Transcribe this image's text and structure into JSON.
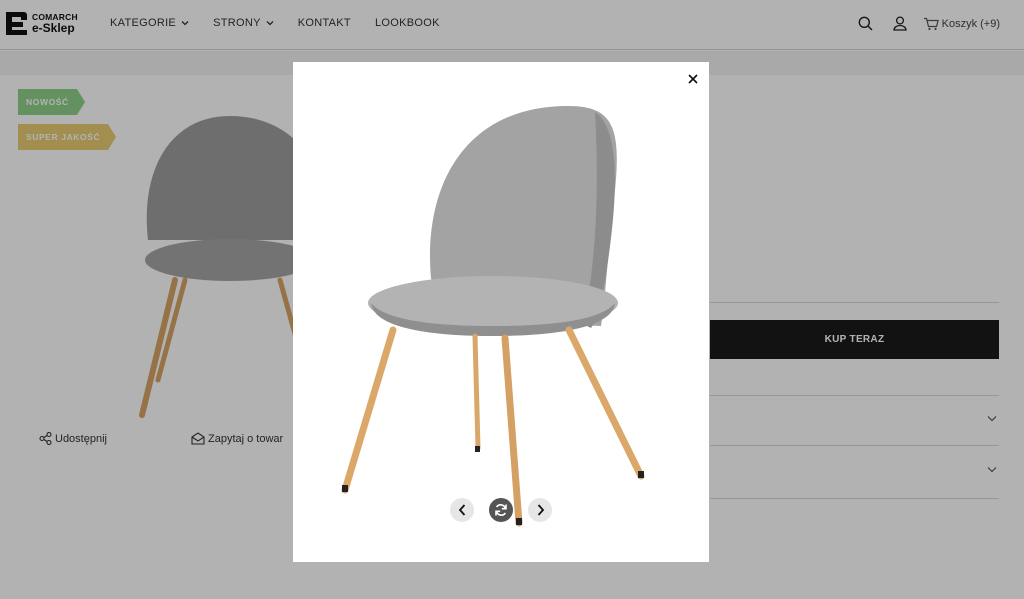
{
  "brand": {
    "line1": "COMARCH",
    "line2": "e-Sklep"
  },
  "nav": [
    {
      "label": "KATEGORIE",
      "dropdown": true
    },
    {
      "label": "STRONY",
      "dropdown": true
    },
    {
      "label": "KONTAKT",
      "dropdown": false
    },
    {
      "label": "LOOKBOOK",
      "dropdown": false
    }
  ],
  "header": {
    "cart_label": "Koszyk",
    "cart_count": "(+9)"
  },
  "badges": {
    "new": "NOWOŚĆ",
    "quality": "SUPER JAKOŚĆ"
  },
  "product": {
    "share_label": "Udostępnij",
    "ask_label": "Zapytaj o towar",
    "buy_label": "KUP TERAZ"
  },
  "lightbox": {
    "close_icon": "close-icon",
    "controls": [
      "chevron-left-icon",
      "rotate-icon",
      "chevron-right-icon"
    ]
  },
  "colors": {
    "accent_dark": "#1a1a1a",
    "badge_new": "#8fd18a",
    "badge_quality": "#e9cc72",
    "chair_fabric": "#a3a3a3",
    "chair_wood": "#dba86a"
  }
}
